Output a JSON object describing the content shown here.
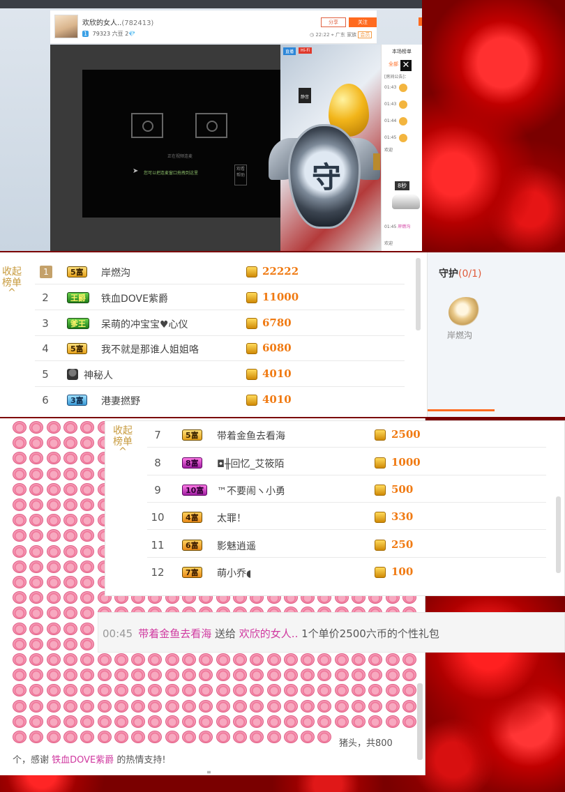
{
  "stream": {
    "host_name": "欢欣的女人..",
    "host_id": "(782413)",
    "level": "1",
    "beans": "79323 六豆",
    "diamonds": "2",
    "share_label": "分享",
    "follow_label": "关注",
    "time": "22:22",
    "location": "广东",
    "family": "家族",
    "family_tag": "会员",
    "live_tag": "直播",
    "hifi_tag": "Hi-Fi",
    "mute_label": "静音",
    "connecting_text": "正在视频连麦",
    "drag_hint": "您可以把连麦窗口拖拽到这里",
    "help_label": "观看帮助",
    "side_title": "本场榜单",
    "side_tab_all": "全部",
    "side_notice": "[房间公告]：",
    "side_rows": [
      "01:43",
      "01:43",
      "01:44",
      "01:45"
    ],
    "side_welcome": "欢迎",
    "side_timer": "8秒",
    "side_bottom_time": "01:45",
    "side_bottom_user": "岸燃沟",
    "side_bottom_welcome": "欢迎",
    "close_label": "✕",
    "guard_glyph": "守"
  },
  "rank_panel": {
    "collapse_label": "收起\n榜单",
    "collapse_line1": "收起",
    "collapse_line2": "榜单",
    "collapse_chevron": "^",
    "rows": [
      {
        "rank": "1",
        "badge": "5富",
        "name": "岸燃沟",
        "amount": "22222"
      },
      {
        "rank": "2",
        "badge": "王爵",
        "name": "铁血DOVE紫爵",
        "amount": "11000"
      },
      {
        "rank": "3",
        "badge": "爹王",
        "name": "呆萌的冲宝宝♥心仪",
        "amount": "6780"
      },
      {
        "rank": "4",
        "badge": "5富",
        "name": "我不就是那谁人姐姐咯",
        "amount": "6080"
      },
      {
        "rank": "5",
        "badge": "",
        "name": "神秘人",
        "amount": "4010"
      },
      {
        "rank": "6",
        "badge": "3富",
        "name": "港妻撚野",
        "amount": "4010"
      }
    ],
    "rows2": [
      {
        "rank": "7",
        "badge": "5富",
        "name": "带着金鱼去看海",
        "amount": "2500"
      },
      {
        "rank": "8",
        "badge": "8富",
        "name": "◘╫回忆_艾筱陌",
        "amount": "1000"
      },
      {
        "rank": "9",
        "badge": "10富",
        "name": "™不要闹ヽ小勇",
        "amount": "500"
      },
      {
        "rank": "10",
        "badge": "4富",
        "name": "太罪！",
        "amount": "330"
      },
      {
        "rank": "11",
        "badge": "6富",
        "name": "影魅逍遥",
        "amount": "250"
      },
      {
        "rank": "12",
        "badge": "7富",
        "name": "萌小乔◖",
        "amount": "100"
      }
    ]
  },
  "guard_panel": {
    "title": "守护",
    "count": "(0/1)",
    "member_name": "岸燃沟"
  },
  "pig_message": {
    "tail_text": "猪头，共800",
    "line2_prefix": "个，感谢 ",
    "line2_user": "铁血DOVE紫爵",
    "line2_suffix": " 的热情支持!",
    "footer_mark": "≡"
  },
  "gift_message": {
    "time": "00:45",
    "sender": "带着金鱼去看海",
    "verb": " 送给 ",
    "receiver": "欢欣的女人..",
    "detail": " 1个单价2500六币的个性礼包"
  },
  "colors": {
    "accent_orange": "#ff6a1f",
    "amount_orange": "#f07a12",
    "user_pink": "#d03aa0",
    "rose_red": "#c00000"
  }
}
